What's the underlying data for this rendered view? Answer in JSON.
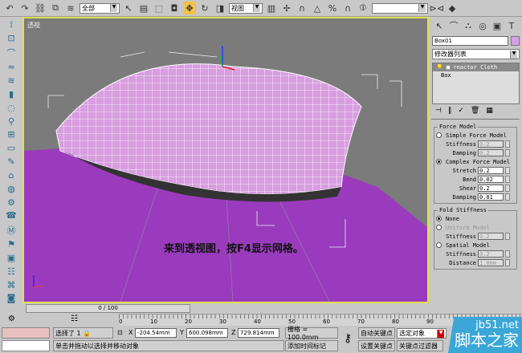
{
  "toolbar": {
    "selection_filter": "全部",
    "ref_coord": "视图",
    "named_selection": ""
  },
  "viewport": {
    "label": "透视",
    "caption": "来到透视图，按F4显示网格。"
  },
  "panel": {
    "object_name": "Box01",
    "modifier_list": "修改器列表",
    "stack": [
      "reactor Cloth",
      "Box"
    ],
    "force_model": {
      "title": "Force Model",
      "simple": "Simple Force Model",
      "stiffness_label": "Stiffness",
      "stiffness": "0.2",
      "damping_label": "Damping",
      "damping": "0.2",
      "complex": "Complex Force Model",
      "stretch_label": "Stretch",
      "stretch": "0.2",
      "bend_label": "Bend",
      "bend": "0.02",
      "shear_label": "Shear",
      "shear": "0.2",
      "cdamping_label": "Damping",
      "cdamping": "0.01"
    },
    "fold": {
      "title": "Fold Stiffness",
      "none": "None",
      "uniform": "Uniform Model",
      "u_stiffness_label": "Stiffness",
      "u_stiffness": "0.2",
      "spatial": "Spatial Model",
      "s_stiffness_label": "Stiffness",
      "s_stiffness": "0.2",
      "distance_label": "Distance",
      "distance": "1.0mm"
    }
  },
  "timeline": {
    "frame": "0 / 100",
    "ticks": [
      "0",
      "10",
      "20",
      "30",
      "40",
      "50",
      "60",
      "70",
      "80",
      "90",
      "100"
    ]
  },
  "status": {
    "selected": "选择了 1",
    "x_label": "X",
    "x": "-204.54mm",
    "y_label": "Y",
    "y": "600.098mm",
    "z_label": "Z",
    "z": "729.814mm",
    "grid": "栅格 = 100.0mm",
    "auto_key": "自动关键点",
    "key_mode": "选定对象",
    "set_key": "设置关键点",
    "key_filters": "关键点过滤器",
    "prompt": "单击并拖动以选择并移动对象",
    "add_time_tag": "添加时间标记"
  },
  "watermark": {
    "site": "jb51.net",
    "name": "脚本之家"
  }
}
